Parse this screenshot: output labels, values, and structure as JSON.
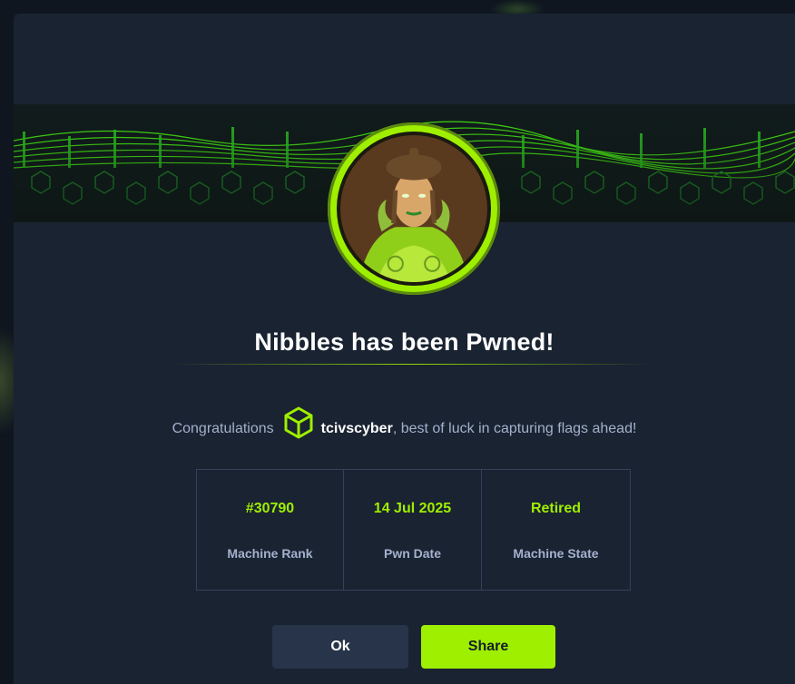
{
  "modal": {
    "title": "Nibbles has been Pwned!",
    "congrats": {
      "prefix": "Congratulations",
      "user_icon": "hexagon-cube-icon",
      "username": "tcivscyber",
      "suffix": ", best of luck in capturing flags ahead!"
    },
    "stats": [
      {
        "value": "#30790",
        "label": "Machine Rank"
      },
      {
        "value": "14 Jul 2025",
        "label": "Pwn Date"
      },
      {
        "value": "Retired",
        "label": "Machine State"
      }
    ],
    "buttons": {
      "ok": "Ok",
      "share": "Share"
    },
    "avatar": "machine-avatar-icon"
  },
  "colors": {
    "accent": "#9fef00",
    "background": "#1a2332",
    "text_muted": "#a4b1cd",
    "border": "#33415a",
    "button_secondary": "#28344a"
  }
}
